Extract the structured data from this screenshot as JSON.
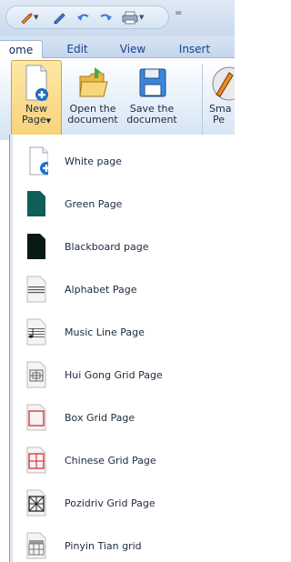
{
  "quick_access": {
    "items": [
      {
        "name": "pen",
        "has_dropdown": true
      },
      {
        "name": "pencil"
      },
      {
        "name": "undo"
      },
      {
        "name": "redo"
      },
      {
        "name": "print",
        "has_dropdown": true
      }
    ],
    "customize_symbol": "="
  },
  "tabs": [
    {
      "label": "ome",
      "active": true
    },
    {
      "label": "Edit"
    },
    {
      "label": "View"
    },
    {
      "label": "Insert"
    }
  ],
  "ribbon": {
    "new_page": {
      "label_line1": "New",
      "label_line2": "Page"
    },
    "open_document": {
      "label_line1": "Open the",
      "label_line2": "document"
    },
    "save_document": {
      "label_line1": "Save the",
      "label_line2": "document"
    },
    "smart_pen": {
      "label_line1": "Sma",
      "label_line2": "Pe"
    }
  },
  "menu": {
    "items": [
      {
        "label": "White page",
        "icon": "white-page-icon"
      },
      {
        "label": "Green Page",
        "icon": "green-page-icon"
      },
      {
        "label": "Blackboard page",
        "icon": "blackboard-page-icon"
      },
      {
        "label": "Alphabet Page",
        "icon": "alphabet-page-icon"
      },
      {
        "label": "Music Line Page",
        "icon": "music-line-page-icon"
      },
      {
        "label": "Hui Gong Grid Page",
        "icon": "hui-gong-grid-icon"
      },
      {
        "label": "Box Grid Page",
        "icon": "box-grid-icon"
      },
      {
        "label": "Chinese Grid Page",
        "icon": "chinese-grid-icon"
      },
      {
        "label": "Pozidriv Grid Page",
        "icon": "pozidriv-grid-icon"
      },
      {
        "label": "Pinyin Tian grid",
        "icon": "pinyin-tian-grid-icon"
      }
    ]
  },
  "colors": {
    "green_page": "#0f5e58",
    "blackboard": "#071a16",
    "grid_red": "#d93a3a",
    "accent_blue": "#1f6fc2"
  }
}
